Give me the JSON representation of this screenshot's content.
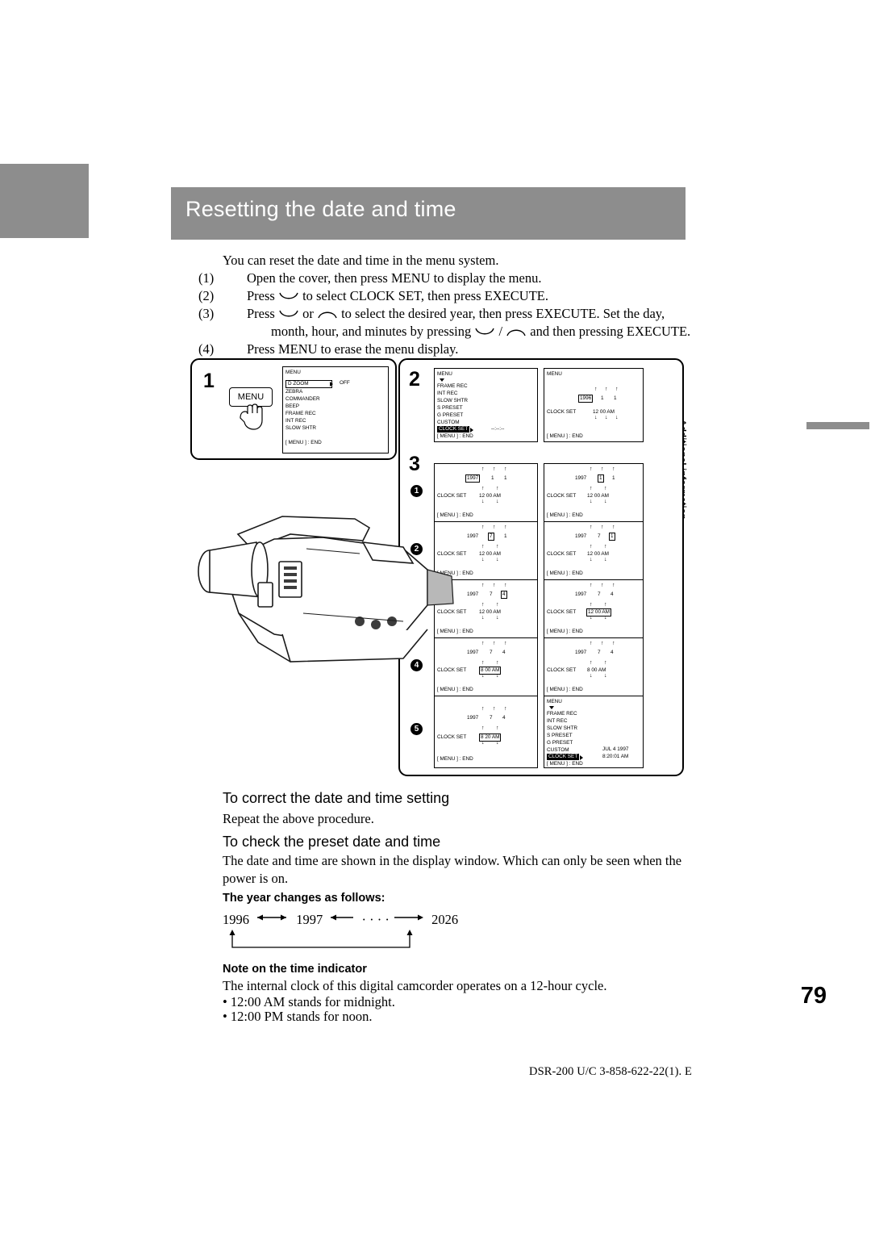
{
  "header": {
    "title": "Resetting the date and time",
    "side_tab_label": "Additional information"
  },
  "intro": {
    "lead": "You can reset the date and time in the menu system.",
    "steps": [
      {
        "num": "(1)",
        "text": "Open the cover, then press MENU to display the menu."
      },
      {
        "num": "(2)",
        "text_a": "Press",
        "text_b": "to select CLOCK SET, then press EXECUTE."
      },
      {
        "num": "(3)",
        "text_a": "Press",
        "text_b": "or",
        "text_c": "to select the desired year, then press EXECUTE. Set the day,",
        "text_d": "month, hour, and minutes by pressing",
        "text_e": "/",
        "text_f": "and then pressing EXECUTE."
      },
      {
        "num": "(4)",
        "text": "Press MENU to erase the menu display."
      }
    ]
  },
  "figure": {
    "step1_number": "1",
    "step2_number": "2",
    "step3_number": "3",
    "menu_button_label": "MENU",
    "menu_card_1": {
      "title": "MENU",
      "rows": [
        "D ZOOM",
        "ZEBRA",
        "COMMANDER",
        "BEEP",
        "FRAME REC",
        "INT REC",
        "SLOW SHTR"
      ],
      "d_zoom_value": "OFF",
      "end": "[ MENU ] : END"
    },
    "menu_card_2a": {
      "title": "MENU",
      "rows": [
        "FRAME REC",
        "INT REC",
        "SLOW SHTR",
        "S PRESET",
        "G PRESET",
        "CUSTOM",
        "CLOCK SET"
      ],
      "value": "--:--:--",
      "end": "[ MENU ] : END"
    },
    "menu_card_2b": {
      "title": "MENU",
      "label": "CLOCK SET",
      "year": "1996",
      "day": "1",
      "month": "1",
      "time": "12  00 AM",
      "end": "[ MENU ] : END"
    },
    "step3_items": [
      {
        "marker": "1",
        "left": {
          "label": "CLOCK SET",
          "year": "1997",
          "day": "1",
          "month": "1",
          "time": "12  00 AM",
          "end": "[ MENU ] : END",
          "highlight": "year"
        },
        "right": {
          "label": "CLOCK SET",
          "year": "1997",
          "day": "1",
          "month": "1",
          "time": "12  00 AM",
          "end": "[ MENU ] : END",
          "highlight": "day"
        }
      },
      {
        "marker": "2",
        "left": {
          "label": "CLOCK SET",
          "year": "1997",
          "day": "7",
          "month": "1",
          "time": "12  00 AM",
          "end": "[ MENU ] : END",
          "highlight": "day"
        },
        "right": {
          "label": "CLOCK SET",
          "year": "1997",
          "day": "7",
          "month": "1",
          "time": "12  00 AM",
          "end": "[ MENU ] : END",
          "highlight": "month"
        }
      },
      {
        "marker": "3",
        "left": {
          "label": "CLOCK SET",
          "year": "1997",
          "day": "7",
          "month": "4",
          "time": "12  00 AM",
          "end": "[ MENU ] : END",
          "highlight": "month"
        },
        "right": {
          "label": "CLOCK SET",
          "year": "1997",
          "day": "7",
          "month": "4",
          "time": "12 00 AM",
          "end": "[ MENU ] : END",
          "highlight": "hour"
        }
      },
      {
        "marker": "4",
        "left": {
          "label": "CLOCK SET",
          "year": "1997",
          "day": "7",
          "month": "4",
          "time": "8 00 AM",
          "end": "[ MENU ] : END",
          "highlight": "hour"
        },
        "right": {
          "label": "CLOCK SET",
          "year": "1997",
          "day": "7",
          "month": "4",
          "time": "8 00 AM",
          "end": "[ MENU ] : END",
          "highlight": "minute"
        }
      },
      {
        "marker": "5",
        "left": {
          "label": "CLOCK SET",
          "year": "1997",
          "day": "7",
          "month": "4",
          "time": "8 20 AM",
          "end": "[ MENU ] : END",
          "highlight": "minute"
        },
        "right": {
          "title": "MENU",
          "rows": [
            "FRAME REC",
            "INT REC",
            "SLOW SHTR",
            "S PRESET",
            "G PRESET",
            "CUSTOM",
            "CLOCK SET"
          ],
          "date_value": "JUL 4 1997",
          "time_value": "8:20:01 AM",
          "end": "[ MENU ] : END"
        }
      }
    ]
  },
  "sections": [
    {
      "heading": "To correct the date and time setting",
      "text": "Repeat the above procedure."
    },
    {
      "heading": "To check the preset date and time",
      "text": "The date and time are shown in the display window. Which can only be seen when the power is on."
    }
  ],
  "year_change": {
    "heading": "The year changes as follows:",
    "start": "1996",
    "second": "1997",
    "dots": "· · · ·",
    "end": "2026"
  },
  "note": {
    "heading": "Note on the time indicator",
    "text": "The internal clock of this digital camcorder operates on a 12-hour cycle.",
    "bullets": [
      "• 12:00 AM stands for midnight.",
      "• 12:00 PM stands for noon."
    ]
  },
  "page_number": "79",
  "footer": "DSR-200 U/C 3-858-622-22(1). E"
}
